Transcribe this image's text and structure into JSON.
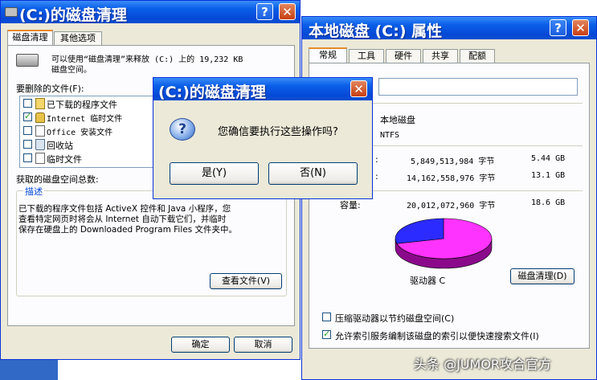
{
  "left_window": {
    "title": "(C:)的磁盘清理",
    "help_button": "?",
    "close_button": "✕",
    "tabs": [
      "磁盘清理",
      "其他选项"
    ],
    "summary": "可以使用“磁盘清理”来释放 (C:) 上的 19,232 KB",
    "summary_line2": "磁盘空间。",
    "files_label": "要删除的文件(F):",
    "files": [
      {
        "label": "已下载的程序文件",
        "checked": false
      },
      {
        "label": "Internet 临时文件",
        "checked": true
      },
      {
        "label": "Office 安装文件",
        "checked": false
      },
      {
        "label": "回收站",
        "checked": false
      },
      {
        "label": "临时文件",
        "checked": false
      }
    ],
    "total_label": "获取的磁盘空间总数:",
    "description_title": "描述",
    "description_lines": [
      "已下载的程序文件包括 ActiveX 控件和 Java 小程序，您",
      "查看特定网页时将会从 Internet 自动下载它们，并临时",
      "保存在硬盘上的 Downloaded Program Files 文件夹中。"
    ],
    "view_files_button": "查看文件(V)",
    "ok_button": "确定",
    "cancel_button": "取消"
  },
  "right_window": {
    "title": "本地磁盘 (C:) 属性",
    "help_button": "?",
    "close_button": "✕",
    "tabs": [
      "常规",
      "工具",
      "硬件",
      "共享",
      "配额"
    ],
    "type_value": "本地磁盘",
    "fs_value": "NTFS",
    "used": {
      "label": ":",
      "bytes": "5,849,513,984 字节",
      "size": "5.44 GB"
    },
    "free": {
      "label": ":",
      "bytes": "14,162,558,976 字节",
      "size": "13.1 GB"
    },
    "capacity": {
      "label": "容量:",
      "bytes": "20,012,072,960 字节",
      "size": "18.6 GB"
    },
    "drive_label": "驱动器 C",
    "cleanup_button": "磁盘清理(D)",
    "compress_option": {
      "label": "压缩驱动器以节约磁盘空间(C)",
      "checked": false
    },
    "index_option": {
      "label": "允许索引服务编制该磁盘的索引以便快速搜索文件(I)",
      "checked": true
    },
    "pie": {
      "used_fraction": 0.29,
      "used_color": "#2b2bff",
      "free_color": "#ff33ff"
    }
  },
  "dialog": {
    "title": "(C:)的磁盘清理",
    "close_button": "✕",
    "message": "您确信要执行这些操作吗?",
    "yes_button": "是(Y)",
    "no_button": "否(N)"
  },
  "watermark": "头条 @JUMOR攻合官方"
}
